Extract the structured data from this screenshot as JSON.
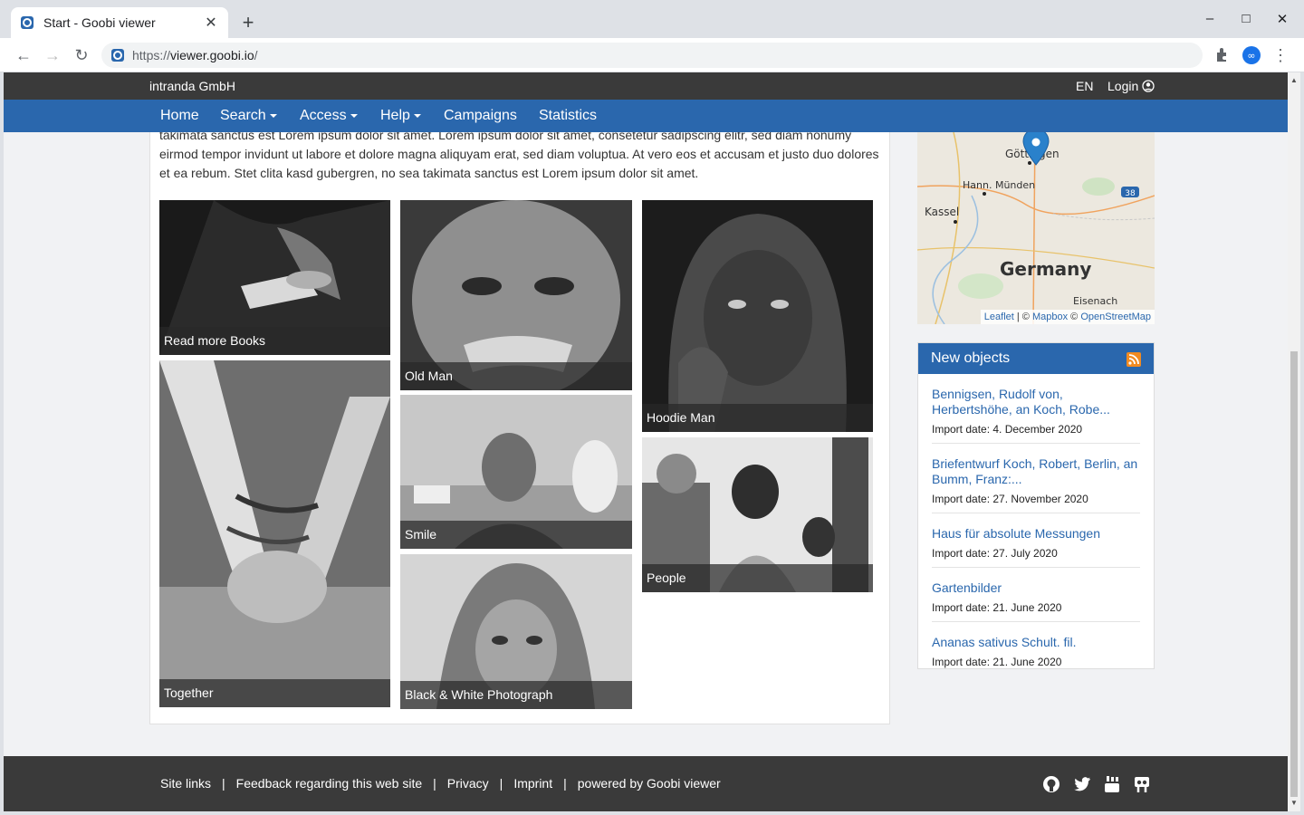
{
  "browser": {
    "tab_title": "Start - Goobi viewer",
    "url_scheme": "https://",
    "url_host": "viewer.goobi.io",
    "url_path": "/"
  },
  "topbar": {
    "brand": "intranda GmbH",
    "language": "EN",
    "login": "Login"
  },
  "nav": {
    "home": "Home",
    "search": "Search",
    "access": "Access",
    "help": "Help",
    "campaigns": "Campaigns",
    "statistics": "Statistics"
  },
  "content": {
    "paragraph": "takimata sanctus est Lorem ipsum dolor sit amet. Lorem ipsum dolor sit amet, consetetur sadipscing elitr, sed diam nonumy eirmod tempor invidunt ut labore et dolore magna aliquyam erat, sed diam voluptua. At vero eos et accusam et justo duo dolores et ea rebum. Stet clita kasd gubergren, no sea takimata sanctus est Lorem ipsum dolor sit amet."
  },
  "gallery": {
    "read_more_books": "Read more Books",
    "together": "Together",
    "old_man": "Old Man",
    "smile": "Smile",
    "black_white": "Black & White Photograph",
    "hoodie_man": "Hoodie Man",
    "people": "People"
  },
  "map": {
    "labels": {
      "goettingen": "Göttingen",
      "hann_muenden": "Hann. Münden",
      "kassel": "Kassel",
      "germany": "Germany",
      "eisenach": "Eisenach",
      "road": "38"
    },
    "attribution": {
      "leaflet": "Leaflet",
      "sep1": "| ©",
      "mapbox": "Mapbox",
      "sep2": "©",
      "osm": "OpenStreetMap"
    }
  },
  "new_objects": {
    "title": "New objects",
    "items": [
      {
        "title": "Bennigsen, Rudolf von, Herbertshöhe, an Koch, Robe...",
        "date": "Import date: 4. December 2020"
      },
      {
        "title": "Briefentwurf Koch, Robert, Berlin, an Bumm, Franz:...",
        "date": "Import date: 27. November 2020"
      },
      {
        "title": "Haus für absolute Messungen",
        "date": "Import date: 27. July 2020"
      },
      {
        "title": "Gartenbilder",
        "date": "Import date: 21. June 2020"
      },
      {
        "title": "Ananas sativus Schult. fil.",
        "date": "Import date: 21. June 2020"
      }
    ]
  },
  "footer": {
    "site_links": "Site links",
    "feedback": "Feedback regarding this web site",
    "privacy": "Privacy",
    "imprint": "Imprint",
    "powered": "powered by Goobi viewer",
    "separator": "|"
  },
  "colors": {
    "primary": "#2a67ad",
    "dark": "#3a3a3a",
    "rss": "#f28b21"
  }
}
